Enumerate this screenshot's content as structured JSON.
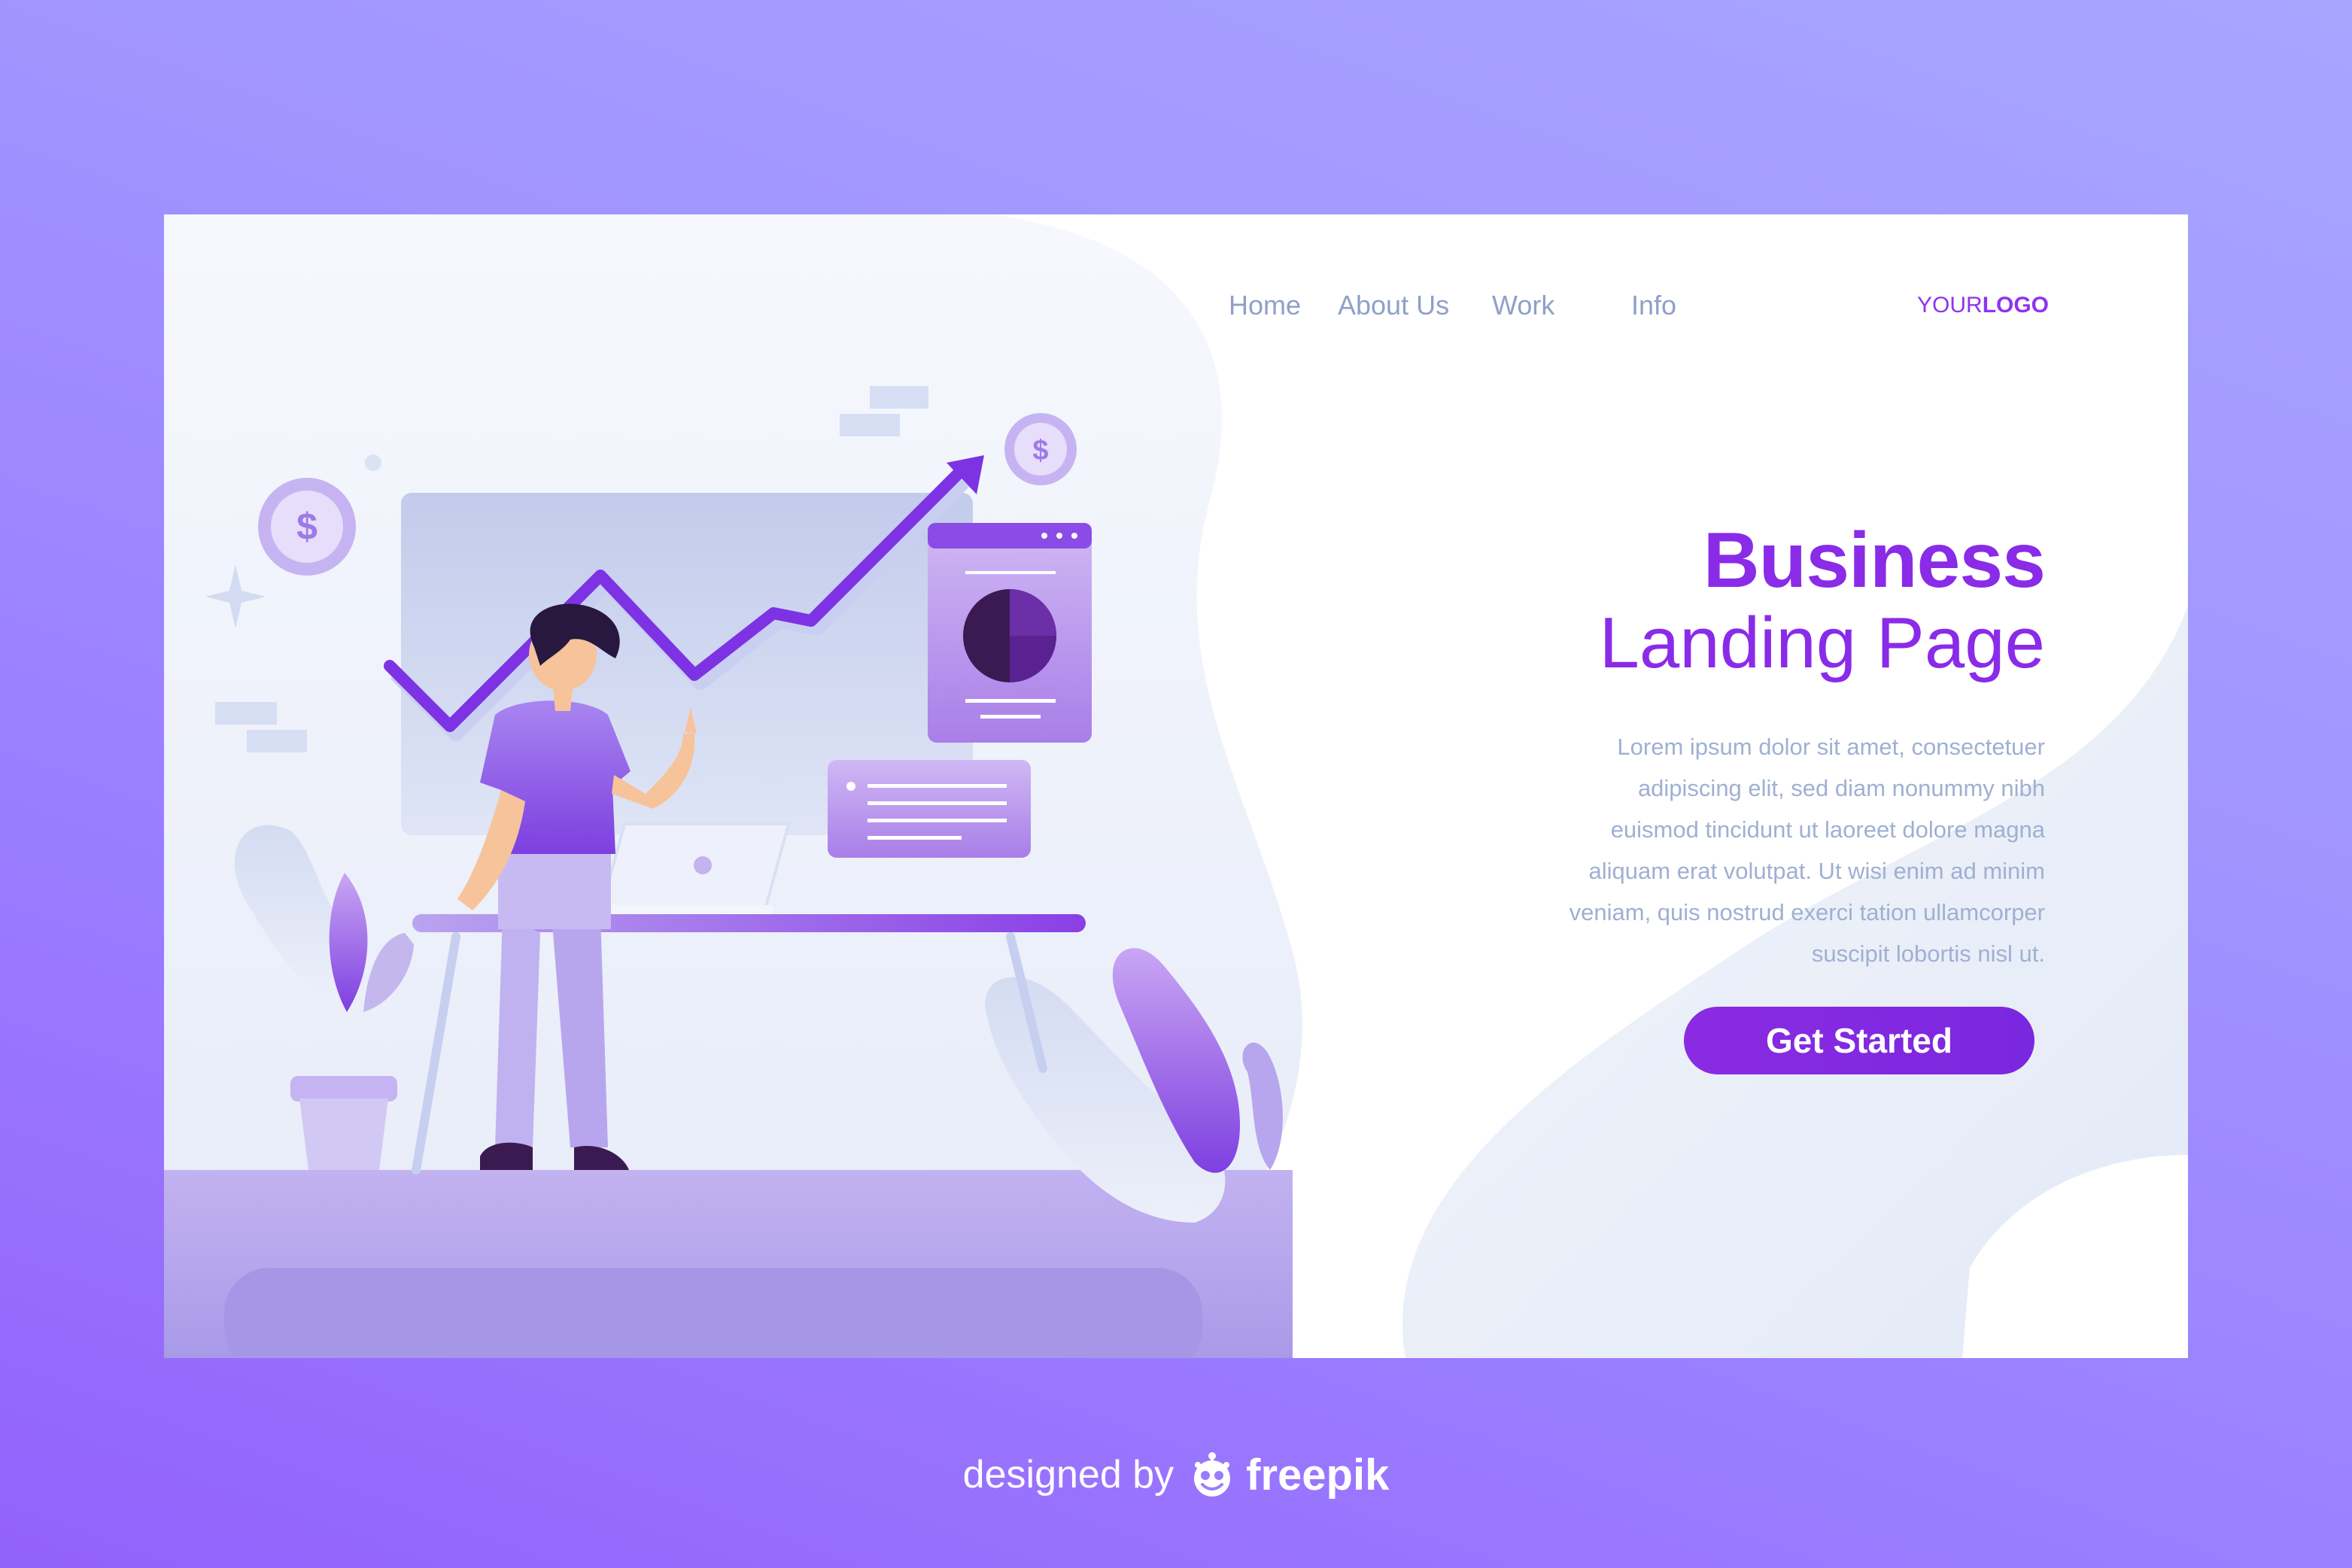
{
  "nav": {
    "items": [
      {
        "label": "Home"
      },
      {
        "label": "About Us"
      },
      {
        "label": "Work"
      },
      {
        "label": "Info"
      }
    ],
    "logo_prefix": "YOUR",
    "logo_suffix": "LOGO"
  },
  "hero": {
    "title_line1": "Business",
    "title_line2": "Landing Page",
    "body_lines": [
      "Lorem ipsum dolor sit amet, consectetuer",
      "adipiscing elit, sed diam nonummy nibh",
      "euismod tincidunt ut laoreet dolore magna",
      "aliquam erat volutpat. Ut wisi enim ad minim",
      "veniam, quis nostrud exerci tation ullamcorper",
      "suscipit lobortis nisl ut."
    ],
    "cta_label": "Get Started"
  },
  "illustration": {
    "coin_symbol_left": "$",
    "coin_symbol_right": "$"
  },
  "credit": {
    "designed_by": "designed by",
    "brand": "freepik"
  },
  "colors": {
    "accent": "#8a2be8",
    "nav_text": "#8fa0c8",
    "body_text": "#9fb0d2",
    "page_bg": "#a295ff"
  },
  "icons": [
    "dollar-coin-icon",
    "growth-arrow-icon",
    "pie-chart-icon",
    "laptop-icon",
    "plant-icon",
    "sparkle-icon",
    "freepik-logo-icon"
  ]
}
